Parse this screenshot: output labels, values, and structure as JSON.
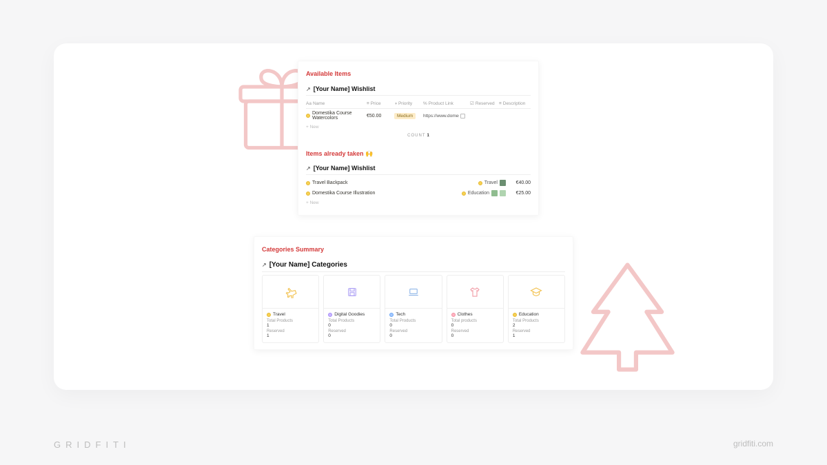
{
  "brand": {
    "name": "GRIDFITI",
    "url": "gridfiti.com"
  },
  "available": {
    "heading": "Available Items",
    "group": "[Your Name] Wishlist",
    "columns": {
      "name": "Name",
      "price": "Price",
      "priority": "Priority",
      "link": "Product Link",
      "reserved": "Reserved",
      "description": "Description"
    },
    "rows": [
      {
        "name": "Domestika Course Watercolors",
        "price": "€50.00",
        "priority": "Medium",
        "link": "https://www.domes"
      }
    ],
    "new_label": "+  New",
    "count_label": "COUNT",
    "count_value": "1"
  },
  "taken": {
    "heading": "Items already taken 🙌",
    "group": "[Your Name] Wishlist",
    "rows": [
      {
        "name": "Travel Backpack",
        "category": "Travel",
        "price": "€40.00"
      },
      {
        "name": "Domestika Course Illustration",
        "category": "Education",
        "price": "€25.00"
      }
    ],
    "new_label": "+  New"
  },
  "categories": {
    "heading": "Categories Summary",
    "group": "[Your Name] Categories",
    "labels": {
      "total": "Total Products",
      "total_alt": "Total products",
      "reserved": "Reserved"
    },
    "cards": [
      {
        "name": "Travel",
        "total": "1",
        "reserved": "1",
        "dot": "yellow",
        "icon": "plane"
      },
      {
        "name": "Digital Goodies",
        "total": "0",
        "reserved": "0",
        "dot": "purple",
        "icon": "floppy"
      },
      {
        "name": "Tech",
        "total": "0",
        "reserved": "0",
        "dot": "blue",
        "icon": "laptop"
      },
      {
        "name": "Clothes",
        "total": "0",
        "reserved": "0",
        "dot": "pink",
        "icon": "shirt",
        "total_label_alt": true
      },
      {
        "name": "Education",
        "total": "2",
        "reserved": "1",
        "dot": "yellow",
        "icon": "grad"
      }
    ]
  }
}
